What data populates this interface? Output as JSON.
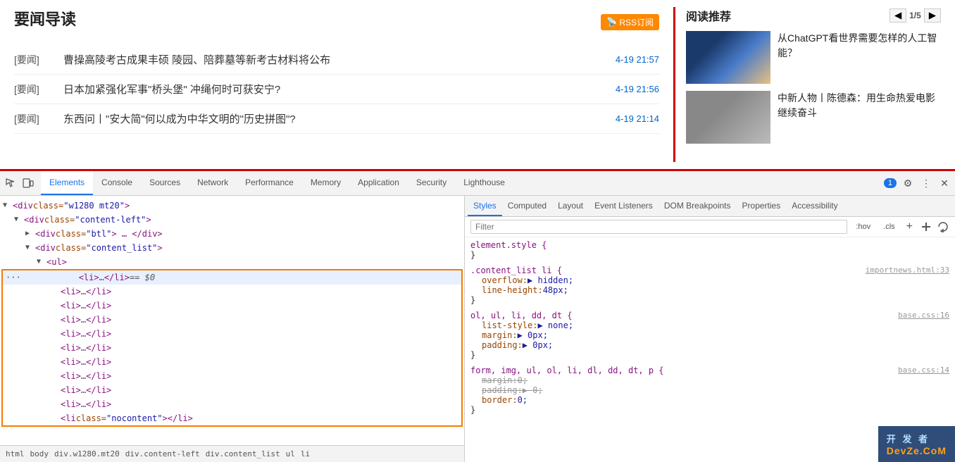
{
  "page": {
    "title": "要闻导读",
    "rss_label": "RSS订阅",
    "news_items": [
      {
        "tag": "[要闻]",
        "title": "曹操高陵考古成果丰硕 陵园、陪葬墓等新考古材料将公布",
        "date": "4-19 21:57"
      },
      {
        "tag": "[要闻]",
        "title": "日本加紧强化军事\"桥头堡\" 冲绳何时可获安宁?",
        "date": "4-19 21:56"
      },
      {
        "tag": "[要闻]",
        "title": "东西问丨\"安大简\"何以成为中华文明的\"历史拼图\"?",
        "date": "4-19 21:14"
      }
    ],
    "right_title": "阅读推荐",
    "pagination": "1/5",
    "cards": [
      {
        "title": "从ChatGPT看世界需要怎样的人工智能？",
        "img_class": "card-img-1"
      },
      {
        "title": "中新人物丨陈德森：用生命热爱电影 继续奋斗",
        "img_class": "card-img-2"
      }
    ]
  },
  "devtools": {
    "tabs": [
      {
        "label": "Elements",
        "active": true
      },
      {
        "label": "Console",
        "active": false
      },
      {
        "label": "Sources",
        "active": false
      },
      {
        "label": "Network",
        "active": false
      },
      {
        "label": "Performance",
        "active": false
      },
      {
        "label": "Memory",
        "active": false
      },
      {
        "label": "Application",
        "active": false
      },
      {
        "label": "Security",
        "active": false
      },
      {
        "label": "Lighthouse",
        "active": false
      }
    ],
    "badge": "1",
    "styles_tabs": [
      {
        "label": "Styles",
        "active": true
      },
      {
        "label": "Computed",
        "active": false
      },
      {
        "label": "Layout",
        "active": false
      },
      {
        "label": "Event Listeners",
        "active": false
      },
      {
        "label": "DOM Breakpoints",
        "active": false
      },
      {
        "label": "Properties",
        "active": false
      },
      {
        "label": "Accessibility",
        "active": false
      }
    ],
    "filter_placeholder": "Filter",
    "hov_label": ":hov",
    "cls_label": ".cls",
    "html_lines": [
      {
        "indent": 0,
        "content": "▼<div class=\"w1280 mt20\">"
      },
      {
        "indent": 1,
        "content": "▼<div class=\"content-left\">"
      },
      {
        "indent": 2,
        "content": "▶<div class=\"btl\"> … </div>"
      },
      {
        "indent": 2,
        "content": "▼<div class=\"content_list\">"
      },
      {
        "indent": 3,
        "content": "▼<ul>"
      },
      {
        "indent": 4,
        "content": "<li> … </li>  == $0",
        "selected": true,
        "highlighted": true
      },
      {
        "indent": 4,
        "content": "<li> … </li>"
      },
      {
        "indent": 4,
        "content": "<li> … </li>"
      },
      {
        "indent": 4,
        "content": "<li> … </li>"
      },
      {
        "indent": 4,
        "content": "<li> … </li>"
      },
      {
        "indent": 4,
        "content": "<li> … </li>"
      },
      {
        "indent": 4,
        "content": "<li> … </li>"
      },
      {
        "indent": 4,
        "content": "<li> … </li>"
      },
      {
        "indent": 4,
        "content": "<li> … </li>"
      },
      {
        "indent": 4,
        "content": "<li> … </li>"
      },
      {
        "indent": 4,
        "content": "<li class=\"nocontent\"></li>"
      }
    ],
    "breadcrumb": [
      "html",
      "body",
      "div.w1280.mt20",
      "div.content-left",
      "div.content_list",
      "ul",
      "li"
    ],
    "styles": [
      {
        "selector": "element.style {",
        "source": "",
        "props": []
      },
      {
        "selector": ".content_list li {",
        "source": "importnews.html:33",
        "props": [
          {
            "name": "overflow:",
            "value": "▶ hidden;",
            "strikethrough": false
          },
          {
            "name": "line-height:",
            "value": "48px;",
            "strikethrough": false
          }
        ]
      },
      {
        "selector": "ol, ul, li, dd, dt {",
        "source": "base.css:16",
        "props": [
          {
            "name": "list-style:",
            "value": "▶ none;",
            "strikethrough": false
          },
          {
            "name": "margin:",
            "value": "▶ 0px;",
            "strikethrough": false
          },
          {
            "name": "padding:",
            "value": "▶ 0px;",
            "strikethrough": false
          }
        ]
      },
      {
        "selector": "form, img, ul, ol, li, dl, dd, dt, p {",
        "source": "base.css:14",
        "props": [
          {
            "name": "margin:",
            "value": "0;",
            "strikethrough": true
          },
          {
            "name": "padding:",
            "value": "▶ 0;",
            "strikethrough": true
          },
          {
            "name": "border:",
            "value": "0;",
            "strikethrough": false
          }
        ]
      }
    ],
    "watermark_line1": "开 发 者",
    "watermark_line2": "DevZe.CoM"
  }
}
